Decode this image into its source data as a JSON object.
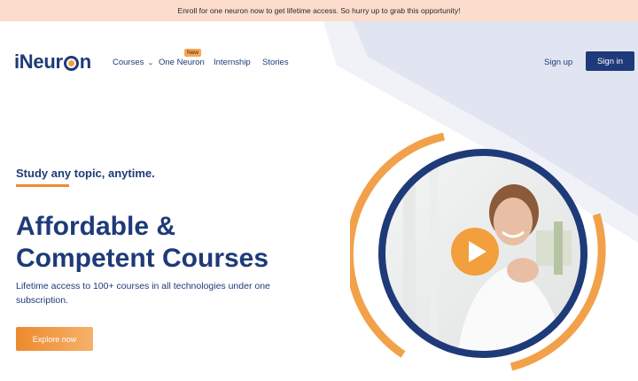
{
  "announcement": {
    "text": "Enroll for one neuron now to get lifetime access. So hurry up to grab this opportunity!"
  },
  "header": {
    "logo_before": "iNeur",
    "logo_after": "n",
    "nav": {
      "courses": "Courses",
      "one_neuron": "One Neuron",
      "new_badge": "New",
      "internship": "Internship",
      "stories": "Stories"
    },
    "sign_up": "Sign up",
    "sign_in": "Sign in"
  },
  "hero": {
    "tagline": "Study any topic, anytime.",
    "headline_line1": "Affordable &",
    "headline_line2": "Competent Courses",
    "subtext": "Lifetime access to 100+ courses in all technologies under one subscription.",
    "cta": "Explore now"
  },
  "colors": {
    "brand_navy": "#1e3a78",
    "accent_orange": "#f29f3d",
    "announcement_bg": "#fcdccd",
    "bg_band": "#e3e6f3"
  },
  "icons": [
    "chevron-down-icon",
    "play-icon",
    "logo-ring-icon"
  ]
}
